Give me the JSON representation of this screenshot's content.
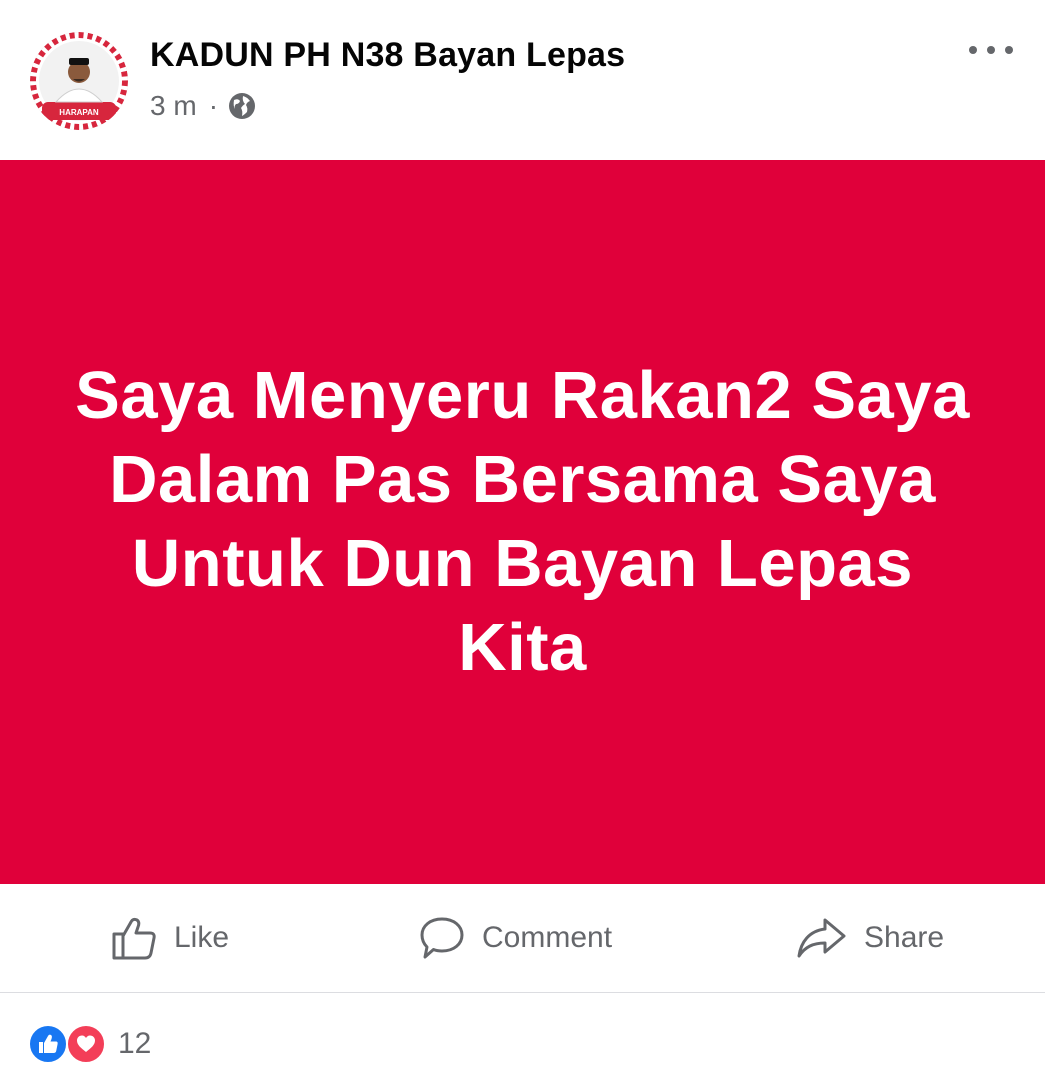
{
  "post": {
    "page_name": "KADUN PH N38 Bayan Lepas",
    "time": "3 m",
    "separator": "·",
    "privacy_icon": "globe-icon",
    "more_icon": "more-options-icon",
    "avatar_banner_text": "HARAPAN",
    "background_color": "#e0003a",
    "text_color": "#ffffff",
    "text": "Saya Menyeru Rakan2 Saya Dalam Pas Bersama Saya Untuk Dun Bayan Lepas Kita"
  },
  "actions": {
    "like_label": "Like",
    "like_icon": "thumbs-up-icon",
    "comment_label": "Comment",
    "comment_icon": "comment-icon",
    "share_label": "Share",
    "share_icon": "share-arrow-icon"
  },
  "reactions": {
    "icons": [
      "like-reaction-icon",
      "love-reaction-icon"
    ],
    "count": "12",
    "like_color": "#1877f2",
    "love_color": "#f33e58"
  }
}
